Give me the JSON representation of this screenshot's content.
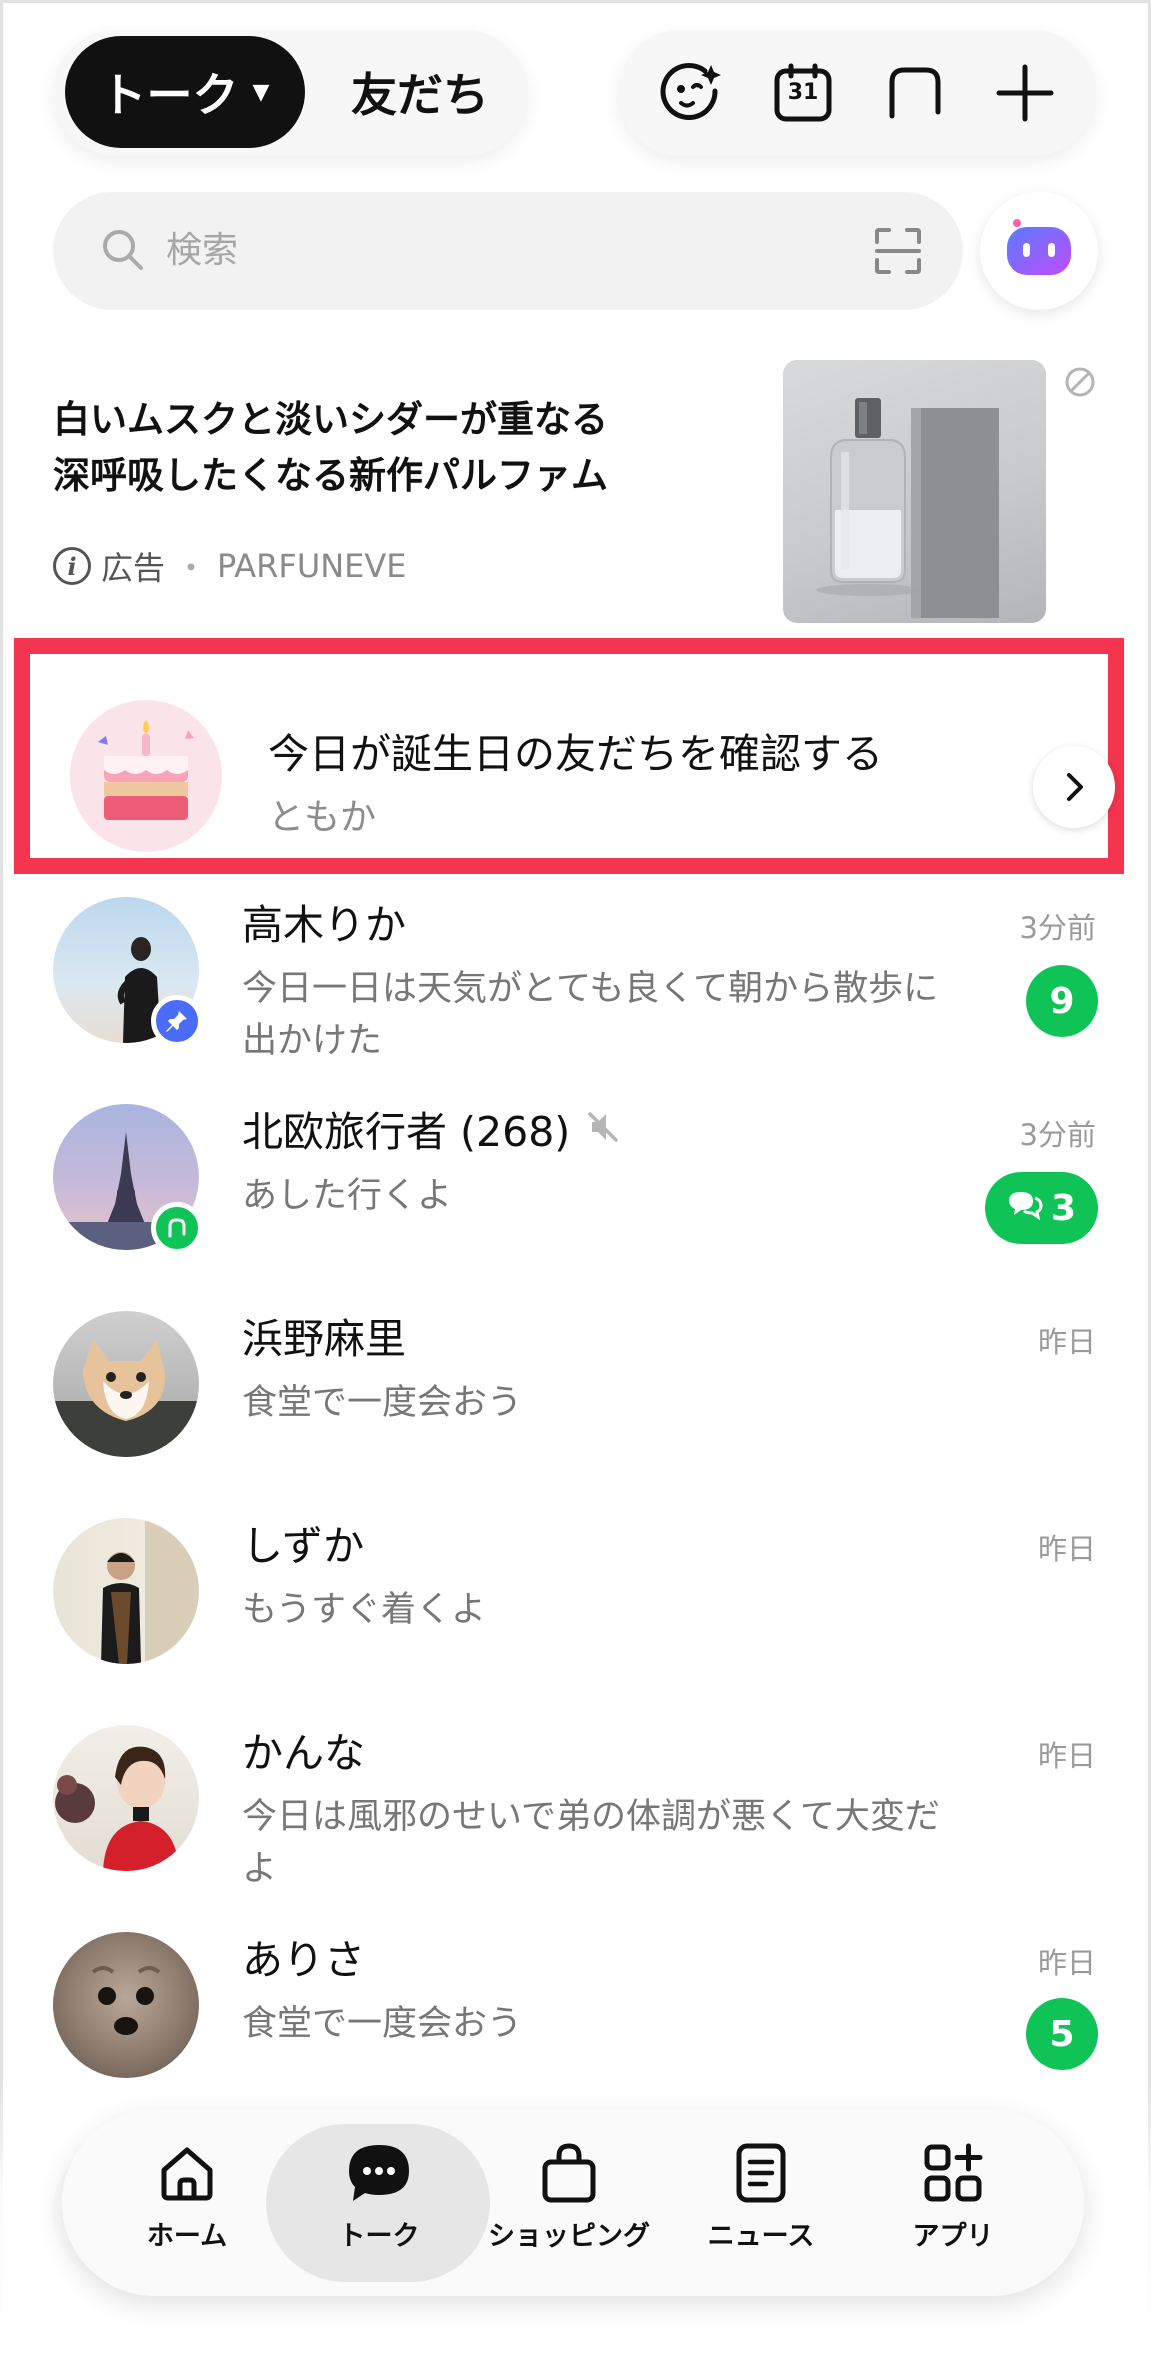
{
  "header": {
    "tab_talk": "トーク",
    "tab_friends": "友だち",
    "icons": [
      "face-sparkle-icon",
      "calendar-icon",
      "new-chat-icon",
      "plus-icon"
    ],
    "calendar_day": "31"
  },
  "search": {
    "placeholder": "検索",
    "icons": [
      "search-icon",
      "qr-scan-icon"
    ],
    "ai_icon": "ai-assistant-icon"
  },
  "ad": {
    "title_line1": "白いムスクと淡いシダーが重なる",
    "title_line2": "深呼吸したくなる新作パルファム",
    "label": "広告",
    "separator": "・",
    "brand": "PARFUNEVE"
  },
  "birthday": {
    "title": "今日が誕生日の友だちを確認する",
    "name": "ともか"
  },
  "chats": [
    {
      "name": "高木りか",
      "message": "今日一日は天気がとても良くて朝から散歩に出かけた",
      "time": "3分前",
      "badge": "9",
      "pinned": true
    },
    {
      "name": "北欧旅行者 (268)",
      "message": "あした行くよ",
      "time": "3分前",
      "badge": "3",
      "muted": true,
      "group": true
    },
    {
      "name": "浜野麻里",
      "message": "食堂で一度会おう",
      "time": "昨日"
    },
    {
      "name": "しずか",
      "message": "もうすぐ着くよ",
      "time": "昨日"
    },
    {
      "name": "かんな",
      "message": "今日は風邪のせいで弟の体調が悪くて大変だよ",
      "time": "昨日"
    },
    {
      "name": "ありさ",
      "message": "食堂で一度会おう",
      "time": "昨日",
      "badge": "5"
    }
  ],
  "nav": [
    {
      "label": "ホーム",
      "icon": "home-icon"
    },
    {
      "label": "トーク",
      "icon": "chat-bubble-icon",
      "selected": true
    },
    {
      "label": "ショッピング",
      "icon": "shopping-bag-icon"
    },
    {
      "label": "ニュース",
      "icon": "news-icon"
    },
    {
      "label": "アプリ",
      "icon": "apps-icon"
    }
  ],
  "colors": {
    "accent_green": "#10c356",
    "highlight_red": "#f3354f",
    "pin_blue": "#4a6cf7"
  }
}
